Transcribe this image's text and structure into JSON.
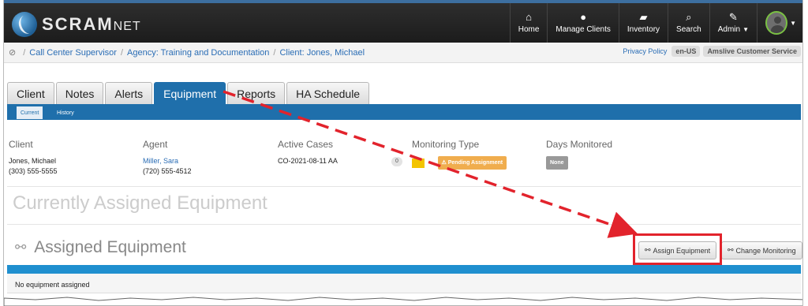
{
  "app": {
    "brand_main": "SCRAM",
    "brand_sub": "NET"
  },
  "nav": {
    "items": [
      {
        "label": "Home",
        "icon": "home-icon"
      },
      {
        "label": "Manage Clients",
        "icon": "user-icon"
      },
      {
        "label": "Inventory",
        "icon": "truck-icon"
      },
      {
        "label": "Search",
        "icon": "search-icon"
      },
      {
        "label": "Admin",
        "icon": "wrench-icon"
      }
    ]
  },
  "breadcrumb": {
    "items": [
      "Call Center Supervisor",
      "Agency: Training and Documentation",
      "Client: Jones, Michael"
    ],
    "privacy": "Privacy Policy",
    "locale": "en-US",
    "service": "Amslive Customer Service"
  },
  "tabs": [
    "Client",
    "Notes",
    "Alerts",
    "Equipment",
    "Reports",
    "HA Schedule"
  ],
  "active_tab": "Equipment",
  "subtabs": [
    "Current",
    "History"
  ],
  "info": {
    "client": {
      "label": "Client",
      "name": "Jones, Michael",
      "phone": "(303) 555-5555"
    },
    "agent": {
      "label": "Agent",
      "name": "Miller, Sara",
      "phone": "(720) 555-4512"
    },
    "cases": {
      "label": "Active Cases",
      "value": "CO-2021-08-11 AA",
      "count": "0"
    },
    "monitoring": {
      "label": "Monitoring Type",
      "status": "Pending Assignment"
    },
    "days": {
      "label": "Days Monitored",
      "value": "None"
    }
  },
  "page": {
    "heading": "Currently Assigned Equipment",
    "section_title": "Assigned Equipment",
    "assign_button": "Assign Equipment",
    "change_button": "Change Monitoring",
    "empty_text": "No equipment assigned"
  },
  "colors": {
    "nav_bg": "#1c1c1c",
    "accent": "#1f6fab",
    "highlight": "#e2232c"
  }
}
